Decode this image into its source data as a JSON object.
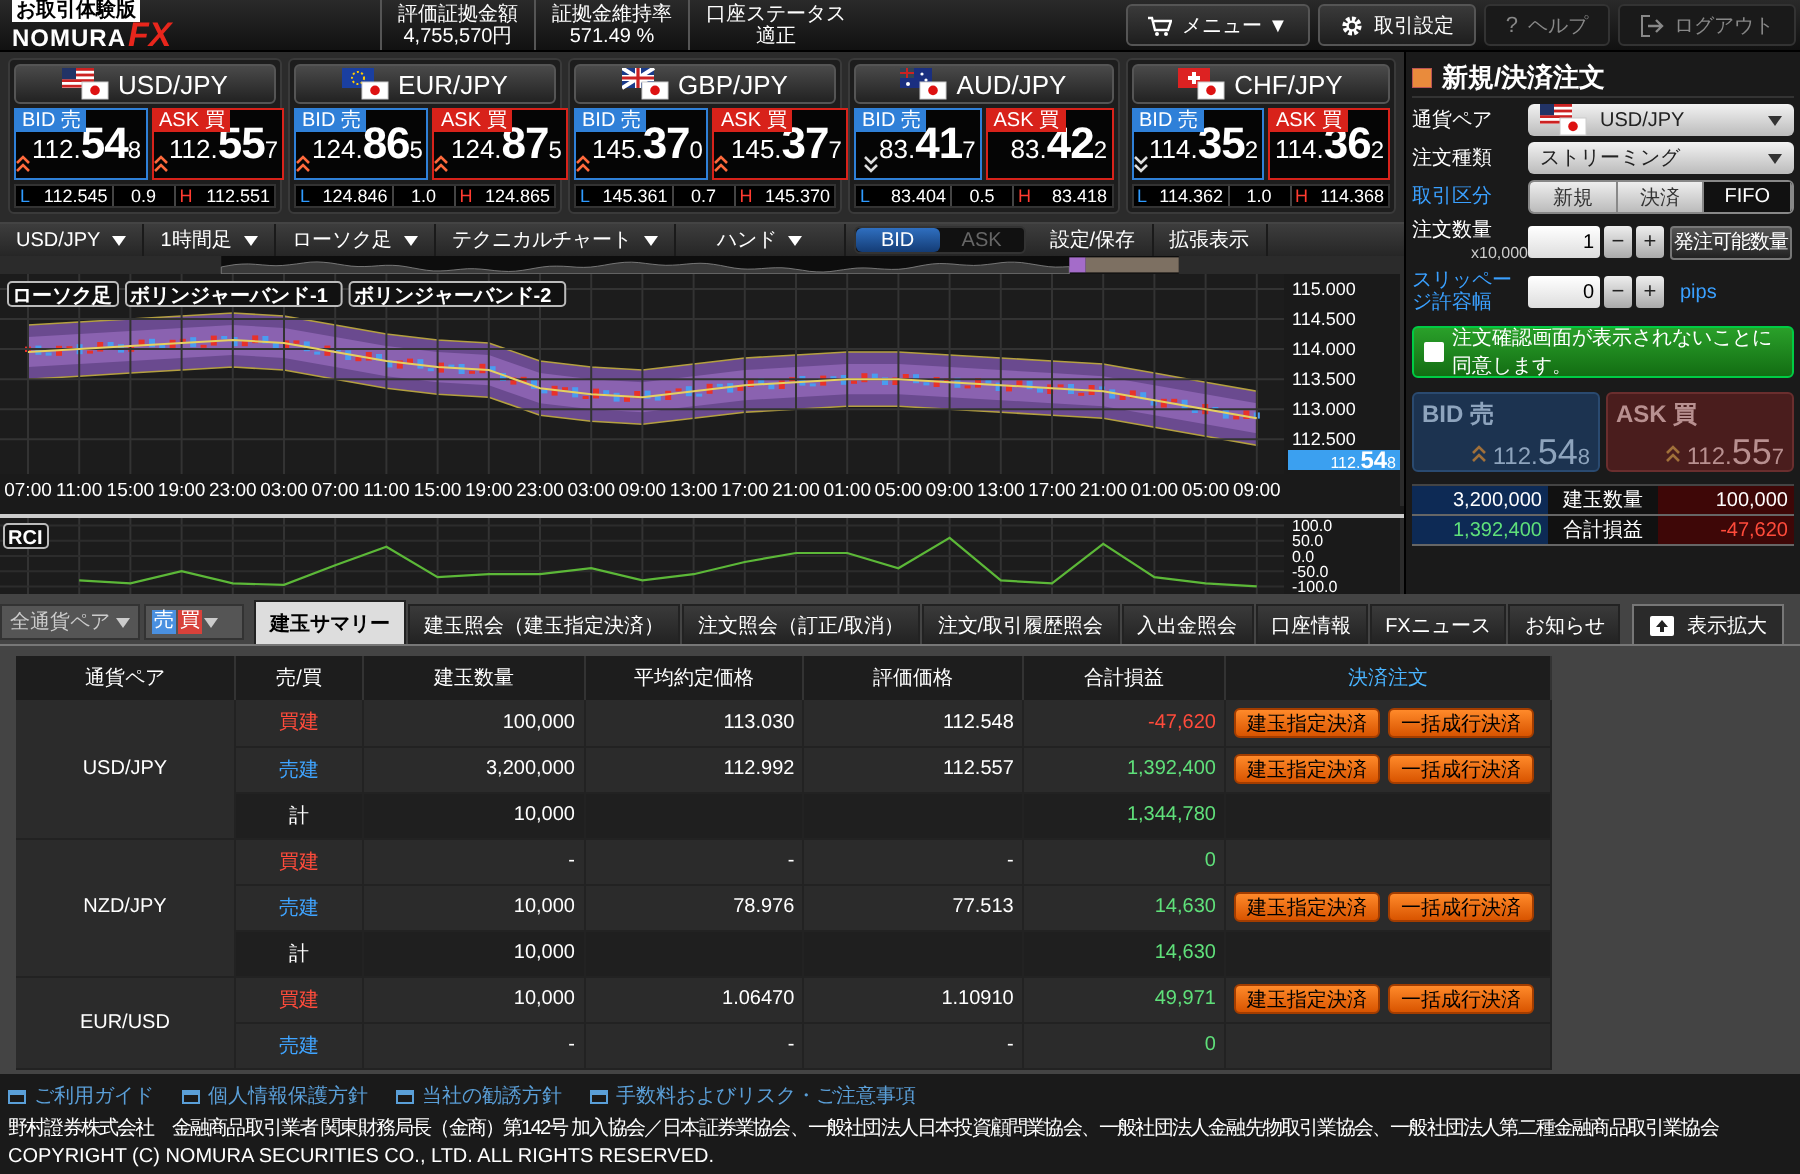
{
  "header": {
    "badge": "お取引体験版",
    "logo_text": "NOMURA",
    "logo_mark": "FX",
    "stats": [
      {
        "label": "評価証拠金額",
        "value": "4,755,570円"
      },
      {
        "label": "証拠金維持率",
        "value": "571.49 %"
      },
      {
        "label": "口座ステータス",
        "value": "適正"
      }
    ],
    "buttons": [
      {
        "kind": "menu",
        "label": "メニュー ▼",
        "disabled": false
      },
      {
        "kind": "settings",
        "label": "取引設定",
        "disabled": false
      },
      {
        "kind": "help",
        "icon_text": "?",
        "label": "ヘルプ",
        "disabled": true
      },
      {
        "kind": "logout",
        "label": "ログアウト",
        "disabled": true
      }
    ]
  },
  "rates": [
    {
      "pair": "USD/JPY",
      "kind": "us",
      "bid_label": "BID 売",
      "bid": {
        "head": "112.",
        "pips": "54",
        "tail": "8",
        "kind": "up"
      },
      "ask_label": "ASK 買",
      "ask": {
        "head": "112.",
        "pips": "55",
        "tail": "7",
        "kind": "up"
      },
      "low_label": "L",
      "low": "112.545",
      "spread": "0.9",
      "high_label": "H",
      "high": "112.551"
    },
    {
      "pair": "EUR/JPY",
      "kind": "eu",
      "bid_label": "BID 売",
      "bid": {
        "head": "124.",
        "pips": "86",
        "tail": "5",
        "kind": "up"
      },
      "ask_label": "ASK 買",
      "ask": {
        "head": "124.",
        "pips": "87",
        "tail": "5",
        "kind": "up"
      },
      "low_label": "L",
      "low": "124.846",
      "spread": "1.0",
      "high_label": "H",
      "high": "124.865"
    },
    {
      "pair": "GBP/JPY",
      "kind": "gb",
      "bid_label": "BID 売",
      "bid": {
        "head": "145.",
        "pips": "37",
        "tail": "0",
        "kind": "up"
      },
      "ask_label": "ASK 買",
      "ask": {
        "head": "145.",
        "pips": "37",
        "tail": "7",
        "kind": "up"
      },
      "low_label": "L",
      "low": "145.361",
      "spread": "0.7",
      "high_label": "H",
      "high": "145.370"
    },
    {
      "pair": "AUD/JPY",
      "kind": "au",
      "bid_label": "BID 売",
      "bid": {
        "head": "83.",
        "pips": "41",
        "tail": "7",
        "kind": "down"
      },
      "ask_label": "ASK 買",
      "ask": {
        "head": "83.",
        "pips": "42",
        "tail": "2",
        "kind": "flat"
      },
      "low_label": "L",
      "low": "83.404",
      "spread": "0.5",
      "high_label": "H",
      "high": "83.418"
    },
    {
      "pair": "CHF/JPY",
      "kind": "ch",
      "bid_label": "BID 売",
      "bid": {
        "head": "114.",
        "pips": "35",
        "tail": "2",
        "kind": "down"
      },
      "ask_label": "ASK 買",
      "ask": {
        "head": "114.",
        "pips": "36",
        "tail": "2",
        "kind": "flat"
      },
      "low_label": "L",
      "low": "114.362",
      "spread": "1.0",
      "high_label": "H",
      "high": "114.368"
    }
  ],
  "chart_toolbar": [
    {
      "kind": "dropdown",
      "label": "USD/JPY"
    },
    {
      "kind": "dropdown",
      "label": "1時間足"
    },
    {
      "kind": "dropdown",
      "label": "ローソク足"
    },
    {
      "kind": "dropdown",
      "label": "テクニカルチャート"
    },
    {
      "kind": "dropdown",
      "label": "ハンド"
    },
    {
      "kind": "toggle",
      "options": [
        {
          "label": "BID",
          "selected": true
        },
        {
          "label": "ASK",
          "selected": false
        }
      ]
    },
    {
      "kind": "button",
      "label": "設定/保存"
    },
    {
      "kind": "button",
      "label": "拡張表示"
    }
  ],
  "price_chart": {
    "legend": [
      "ローソク足",
      "ボリンジャーバンド-2"
    ],
    "current_price": {
      "head": "112.",
      "pips": "54",
      "tail": "8"
    },
    "chart_data": {
      "type": "line",
      "grid": true,
      "x": [
        "07:00",
        "11:00",
        "15:00",
        "19:00",
        "23:00",
        "03:00",
        "07:00",
        "11:00",
        "15:00",
        "19:00",
        "23:00",
        "03:00",
        "09:00",
        "13:00",
        "17:00",
        "21:00",
        "01:00",
        "05:00",
        "09:00",
        "13:00",
        "17:00",
        "21:00",
        "01:00",
        "05:00",
        "09:00"
      ],
      "ylim": [
        111.92,
        115.25
      ],
      "yticks": [
        {
          "value": 115,
          "label": "115.000"
        },
        {
          "value": 114.5,
          "label": "114.500"
        },
        {
          "value": 114,
          "label": "114.000"
        },
        {
          "value": 113.5,
          "label": "113.500"
        },
        {
          "value": 113,
          "label": "113.000"
        },
        {
          "value": 112.5,
          "label": "112.500"
        }
      ],
      "series": [
        {
          "name": "ボリンジャーバンド-1",
          "color": "#e6d060",
          "values": [
            113.95,
            114.0,
            114.05,
            114.1,
            114.15,
            114.1,
            113.95,
            113.8,
            113.7,
            113.65,
            113.35,
            113.25,
            113.2,
            113.3,
            113.4,
            113.45,
            113.5,
            113.5,
            113.45,
            113.4,
            113.35,
            113.3,
            113.15,
            113.0,
            112.85
          ]
        }
      ]
    }
  },
  "rci_chart": {
    "chart_data": {
      "type": "line",
      "grid": true,
      "ylim": [
        -125,
        125
      ],
      "yticks": [
        {
          "value": 100,
          "label": "100.0"
        },
        {
          "value": 50,
          "label": "50.0"
        },
        {
          "value": 0,
          "label": "0.0"
        },
        {
          "value": -50,
          "label": "-50.0"
        },
        {
          "value": -100,
          "label": "-100.0"
        }
      ],
      "series": [
        {
          "name": "RCI",
          "color": "#5cb838",
          "values": [
            null,
            -80,
            -90,
            -50,
            -90,
            -95,
            -30,
            30,
            -70,
            -60,
            -60,
            -40,
            -80,
            -60,
            -20,
            10,
            10,
            -40,
            60,
            -80,
            -90,
            40,
            -70,
            -90,
            -100
          ]
        }
      ]
    }
  },
  "order_panel": {
    "title": "新規/決済注文",
    "fields": [
      {
        "kind": "pair_select",
        "label": "通貨ペア",
        "link": false,
        "value": "USD/JPY"
      },
      {
        "kind": "select",
        "label": "注文種類",
        "link": false,
        "value": "ストリーミング"
      },
      {
        "kind": "segment",
        "label": "取引区分",
        "link": true,
        "options": [
          {
            "label": "新規",
            "selected": false
          },
          {
            "label": "決済",
            "selected": false
          },
          {
            "label": "FIFO",
            "selected": true
          }
        ]
      },
      {
        "kind": "stepper",
        "label": "注文数量",
        "link": false,
        "sublabel": "x10,000",
        "value": "1",
        "minus": "−",
        "plus": "+",
        "extra_button": "発注可能数量"
      },
      {
        "kind": "stepper",
        "label": "スリッページ許容幅",
        "link": true,
        "value": "0",
        "minus": "−",
        "plus": "+",
        "unit": "pips"
      }
    ],
    "confirm": {
      "label": "注文確認画面が表示されないことに同意します。",
      "checked": false
    },
    "bid": {
      "label": "BID 売",
      "head": "112.",
      "pips": "54",
      "tail": "8"
    },
    "ask": {
      "label": "ASK 買",
      "head": "112.",
      "pips": "55",
      "tail": "7"
    },
    "summary": [
      {
        "left": {
          "text": "3,200,000",
          "color": "#ffffff"
        },
        "label": "建玉数量",
        "right": {
          "text": "100,000",
          "color": "#ffffff"
        }
      },
      {
        "left": {
          "text": "1,392,400",
          "color": "#5fe07a"
        },
        "label": "合計損益",
        "right": {
          "text": "-47,620",
          "color": "#ff4b3b"
        }
      }
    ]
  },
  "bottom": {
    "pair_filter": "全通貨ペア",
    "side_filter": {
      "sell": "売",
      "buy": "買"
    },
    "tabs": [
      {
        "label": "建玉サマリー",
        "selected": true
      },
      {
        "label": "建玉照会（建玉指定決済）",
        "selected": false
      },
      {
        "label": "注文照会（訂正/取消）",
        "selected": false
      },
      {
        "label": "注文/取引履歴照会",
        "selected": false
      },
      {
        "label": "入出金照会",
        "selected": false
      },
      {
        "label": "口座情報",
        "selected": false
      },
      {
        "label": "FXニュース",
        "selected": false
      },
      {
        "label": "お知らせ",
        "selected": false
      }
    ],
    "expand_button": "表示拡大"
  },
  "positions_table": {
    "columns": [
      "通貨ペア",
      "売/買",
      "建玉数量",
      "平均約定価格",
      "評価価格",
      "合計損益",
      "決済注文"
    ],
    "groups": [
      {
        "pair": "USD/JPY",
        "rows": [
          {
            "kind": "buy",
            "side": "買建",
            "quantity": "100,000",
            "average_price": "113.030",
            "valuation_price": "112.548",
            "pnl": "-47,620",
            "color": "#ff4b3b",
            "actions": [
              "建玉指定決済",
              "一括成行決済"
            ]
          },
          {
            "kind": "sell",
            "side": "売建",
            "quantity": "3,200,000",
            "average_price": "112.992",
            "valuation_price": "112.557",
            "pnl": "1,392,400",
            "color": "#5fe07a",
            "actions": [
              "建玉指定決済",
              "一括成行決済"
            ]
          },
          {
            "kind": "total",
            "side": "計",
            "quantity": "10,000",
            "pnl": "1,344,780",
            "color": "#5fe07a"
          }
        ]
      },
      {
        "pair": "NZD/JPY",
        "rows": [
          {
            "kind": "buy",
            "side": "買建",
            "quantity": "-",
            "average_price": "-",
            "valuation_price": "-",
            "pnl": "0",
            "color": "#5fe07a"
          },
          {
            "kind": "sell",
            "side": "売建",
            "quantity": "10,000",
            "average_price": "78.976",
            "valuation_price": "77.513",
            "pnl": "14,630",
            "color": "#5fe07a",
            "actions": [
              "建玉指定決済",
              "一括成行決済"
            ]
          },
          {
            "kind": "total",
            "side": "計",
            "quantity": "10,000",
            "pnl": "14,630",
            "color": "#5fe07a"
          }
        ]
      },
      {
        "pair": "EUR/USD",
        "rows": [
          {
            "kind": "buy",
            "side": "買建",
            "quantity": "10,000",
            "average_price": "1.06470",
            "valuation_price": "1.10910",
            "pnl": "49,971",
            "color": "#5fe07a",
            "actions": [
              "建玉指定決済",
              "一括成行決済"
            ]
          },
          {
            "kind": "sell",
            "side": "売建",
            "quantity": "-",
            "average_price": "-",
            "valuation_price": "-",
            "pnl": "0",
            "color": "#5fe07a"
          }
        ]
      }
    ]
  },
  "footer": {
    "links": [
      "ご利用ガイド",
      "個人情報保護方針",
      "当社の勧誘方針",
      "手数料およびリスク・ご注意事項"
    ],
    "company": "野村證券株式会社　金融商品取引業者 関東財務局長（金商）第142号 加入協会／日本証券業協会、一般社団法人日本投資顧問業協会、一般社団法人金融先物取引業協会、一般社団法人第二種金融商品取引業協会",
    "copyright": "COPYRIGHT (C) NOMURA SECURITIES CO., LTD. ALL RIGHTS RESERVED."
  }
}
